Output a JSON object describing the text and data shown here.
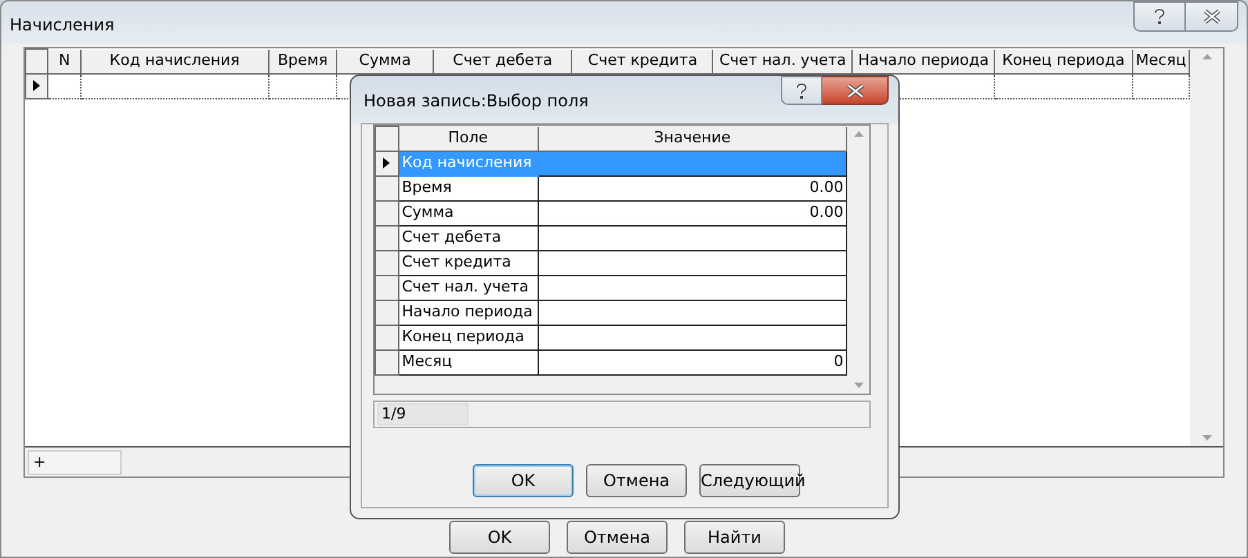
{
  "window": {
    "title": "Начисления"
  },
  "grid": {
    "columns": [
      "N",
      "Код начисления",
      "Время",
      "Сумма",
      "Счет дебета",
      "Счет кредита",
      "Счет нал. учета",
      "Начало периода",
      "Конец периода",
      "Месяц"
    ],
    "rows": [
      {
        "current": true
      }
    ],
    "navigator": "+"
  },
  "buttons": [
    {
      "label": "OK",
      "default": false
    },
    {
      "label": "Отмена",
      "default": false
    },
    {
      "label": "Найти",
      "default": false
    }
  ],
  "dialog": {
    "title": "Новая запись:Выбор поля",
    "columns": [
      "Поле",
      "Значение"
    ],
    "rows": [
      {
        "field": "Код начисления",
        "value": "",
        "current": true
      },
      {
        "field": "Время",
        "value": "0.00",
        "current": false
      },
      {
        "field": "Сумма",
        "value": "0.00",
        "current": false
      },
      {
        "field": "Счет дебета",
        "value": "",
        "current": false
      },
      {
        "field": "Счет кредита",
        "value": "",
        "current": false
      },
      {
        "field": "Счет нал. учета",
        "value": "",
        "current": false
      },
      {
        "field": "Начало периода",
        "value": "",
        "current": false
      },
      {
        "field": "Конец периода",
        "value": "",
        "current": false
      },
      {
        "field": "Месяц",
        "value": "0",
        "current": false
      }
    ],
    "position": "1/9",
    "buttons": [
      {
        "label": "OK",
        "default": true
      },
      {
        "label": "Отмена",
        "default": false
      },
      {
        "label": "Следующий",
        "default": false
      }
    ]
  }
}
